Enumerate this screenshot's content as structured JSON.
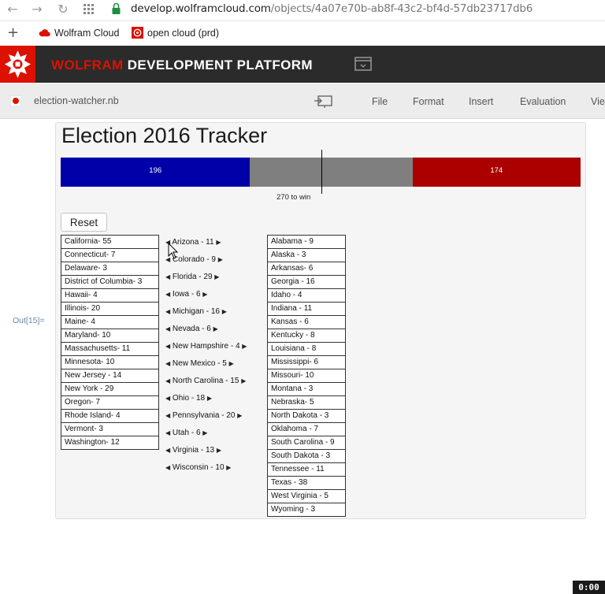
{
  "browser": {
    "url_host": "develop.wolframcloud.com",
    "url_path": "/objects/4a07e70b-ab8f-43c2-bf4d-57db23717db6",
    "bookmarks": [
      "Wolfram Cloud",
      "open cloud (prd)"
    ],
    "icons": {
      "back": "back-arrow-icon",
      "forward": "forward-arrow-icon",
      "reload": "reload-icon",
      "apps": "apps-grid-icon",
      "lock": "lock-icon",
      "add": "plus-icon"
    }
  },
  "header": {
    "brand": "WOLFRAM",
    "title": "DEVELOPMENT PLATFORM",
    "brand_color": "#dd1100",
    "background": "#2b2b2b"
  },
  "toolbar": {
    "notebook_name": "election-watcher.nb",
    "menus": [
      "File",
      "Format",
      "Insert",
      "Evaluation",
      "View"
    ]
  },
  "output": {
    "label": "Out[15]=",
    "title": "Election 2016 Tracker",
    "total_electoral_votes": 538,
    "dem_votes": 196,
    "rep_votes": 174,
    "dem_votes_label": "196",
    "rep_votes_label": "174",
    "win_threshold": 270,
    "win_label": "270 to win",
    "reset_label": "Reset",
    "colors": {
      "dem": "#0000a8",
      "rep": "#aa0000",
      "undecided": "#7f7f7f"
    },
    "dem_states": [
      "California- 55",
      "Connecticut- 7",
      "Delaware- 3",
      "District of Columbia- 3",
      "Hawaii- 4",
      "Illinois- 20",
      "Maine- 4",
      "Maryland- 10",
      "Massachusetts- 11",
      "Minnesota- 10",
      "New Jersey - 14",
      "New York - 29",
      "Oregon- 7",
      "Rhode Island- 4",
      "Vermont- 3",
      "Washington- 12"
    ],
    "swing_states": [
      "Arizona - 11",
      "Colorado - 9",
      "Florida - 29",
      "Iowa - 6",
      "Michigan - 16",
      "Nevada - 6",
      "New Hampshire - 4",
      "New Mexico - 5",
      "North Carolina - 15",
      "Ohio - 18",
      "Pennsylvania - 20",
      "Utah - 6",
      "Virginia - 13",
      "Wisconsin - 10"
    ],
    "rep_states": [
      "Alabama - 9",
      "Alaska - 3",
      "Arkansas- 6",
      "Georgia - 16",
      "Idaho - 4",
      "Indiana - 11",
      "Kansas - 6",
      "Kentucky - 8",
      "Louisiana - 8",
      "Mississippi- 6",
      "Missouri- 10",
      "Montana - 3",
      "Nebraska- 5",
      "North Dakota - 3",
      "Oklahoma - 7",
      "South Carolina - 9",
      "South Dakota - 3",
      "Tennessee - 11",
      "Texas - 38",
      "West Virginia - 5",
      "Wyoming - 3"
    ]
  },
  "recorder": {
    "time": "0:00"
  }
}
